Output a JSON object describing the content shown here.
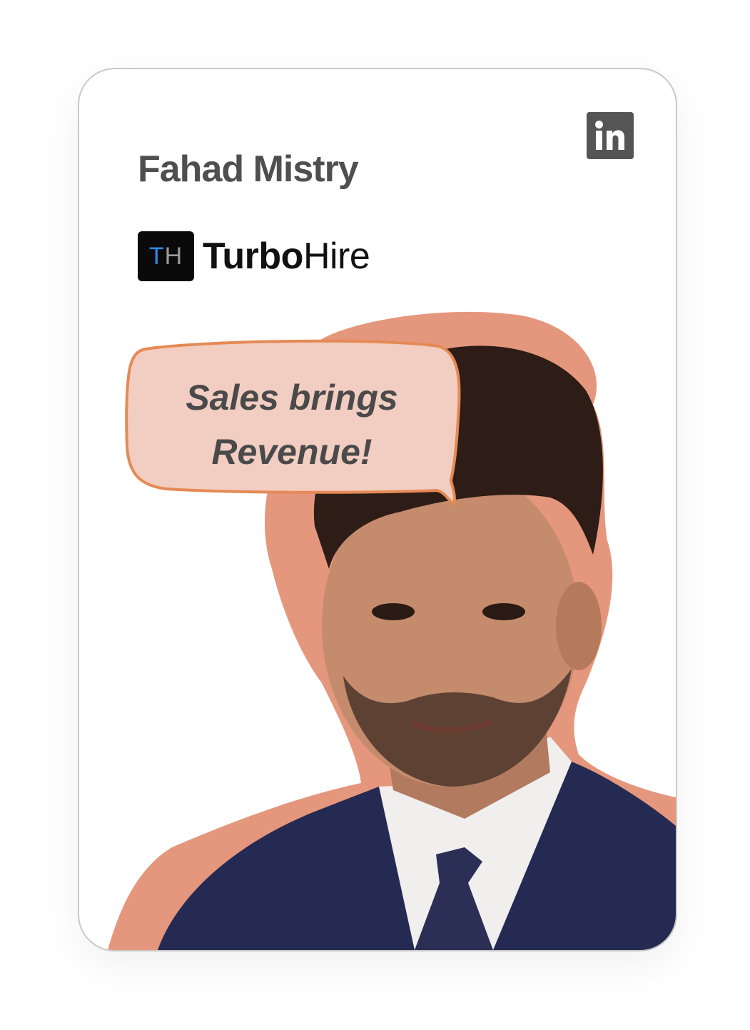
{
  "profile": {
    "name": "Fahad Mistry",
    "quote_line1": "Sales brings",
    "quote_line2": "Revenue!"
  },
  "brand": {
    "mark_t": "T",
    "mark_h": "H",
    "name_bold": "Turbo",
    "name_light": "Hire"
  },
  "icons": {
    "social": "linkedin-icon",
    "photo": "person-portrait"
  },
  "colors": {
    "accent_salmon": "#e5977d",
    "bubble_fill": "#f2cdc2",
    "bubble_stroke": "#e58a55",
    "linkedin_box": "#555555",
    "brand_blue": "#2f8ae6",
    "suit_navy": "#252a52"
  }
}
